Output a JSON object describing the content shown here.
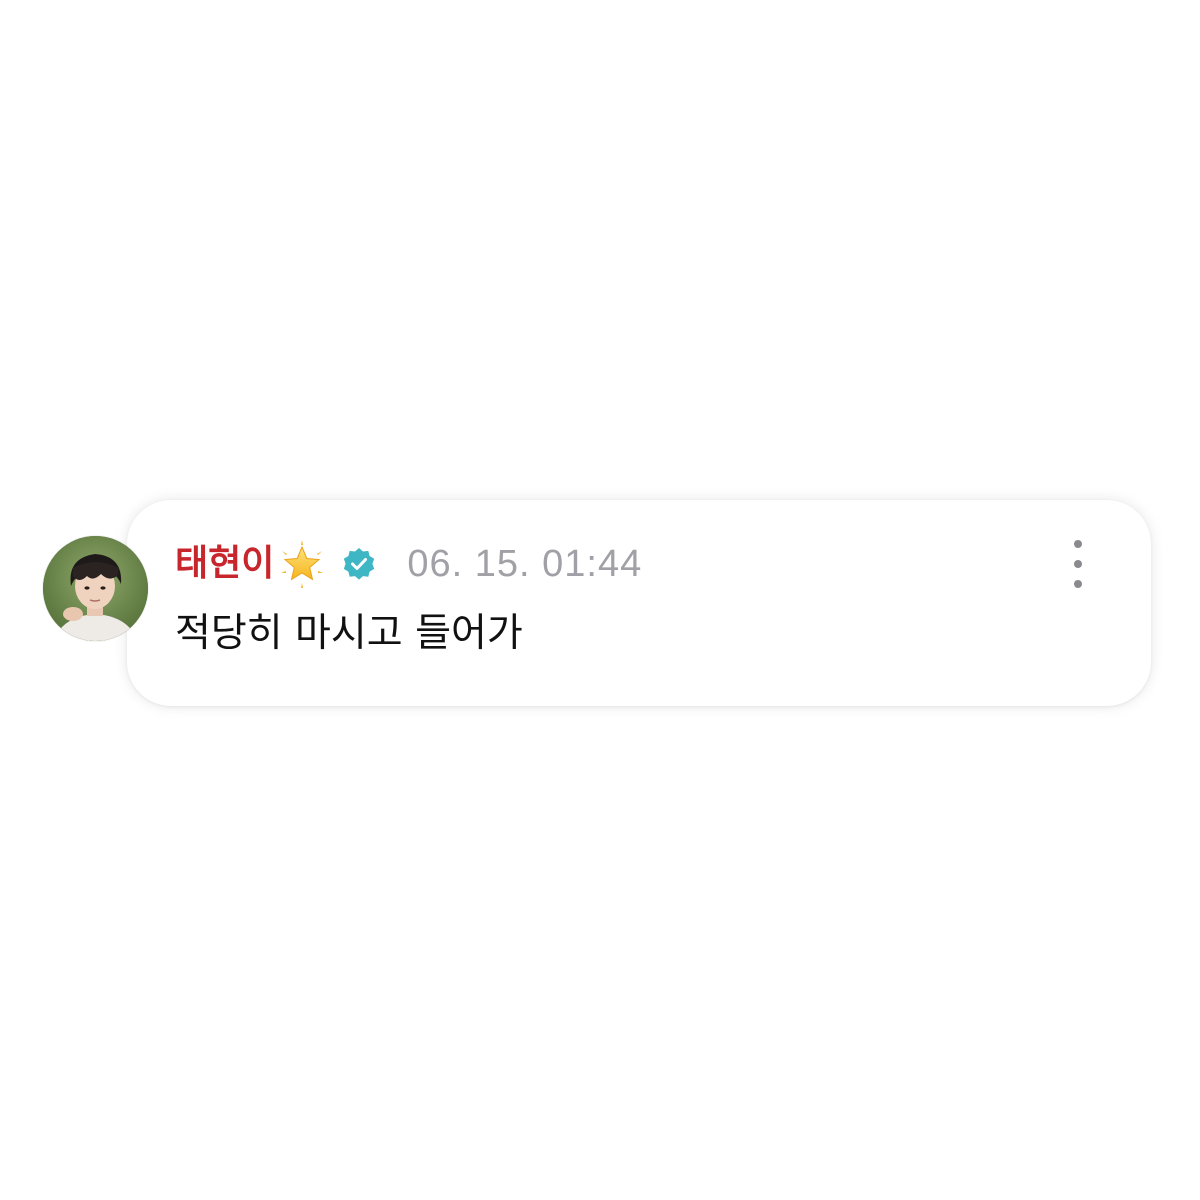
{
  "comment": {
    "author": "태현이",
    "timestamp": "06. 15. 01:44",
    "text": "적당히 마시고 들어가",
    "badges": {
      "emoji": "glowing-star-icon",
      "verified": "verified-check-icon"
    },
    "more_menu_icon": "more-vertical-icon"
  },
  "colors": {
    "author_name": "#c8262d",
    "timestamp": "#a0a0a6",
    "verified_badge": "#3fb6c4",
    "card_background": "#ffffff"
  }
}
